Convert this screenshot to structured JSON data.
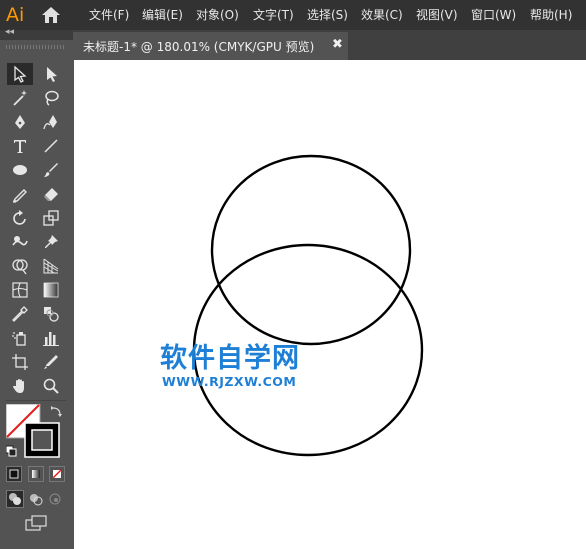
{
  "app": {
    "logo_text": "Ai"
  },
  "menu": {
    "items": [
      {
        "label": "文件(F)"
      },
      {
        "label": "编辑(E)"
      },
      {
        "label": "对象(O)"
      },
      {
        "label": "文字(T)"
      },
      {
        "label": "选择(S)"
      },
      {
        "label": "效果(C)"
      },
      {
        "label": "视图(V)"
      },
      {
        "label": "窗口(W)"
      },
      {
        "label": "帮助(H)"
      }
    ]
  },
  "toolbar": {
    "collapse_glyph": "◂◂"
  },
  "tab": {
    "title": "未标题-1* @ 180.01% (CMYK/GPU 预览)",
    "close_glyph": "✖"
  },
  "watermark": {
    "title": "软件自学网",
    "url": "WWW.RJZXW.COM"
  },
  "colors": {
    "accent_logo": "#ff9a00",
    "watermark": "#1e7fd6",
    "canvas": "#ffffff",
    "chrome": "#535353"
  }
}
